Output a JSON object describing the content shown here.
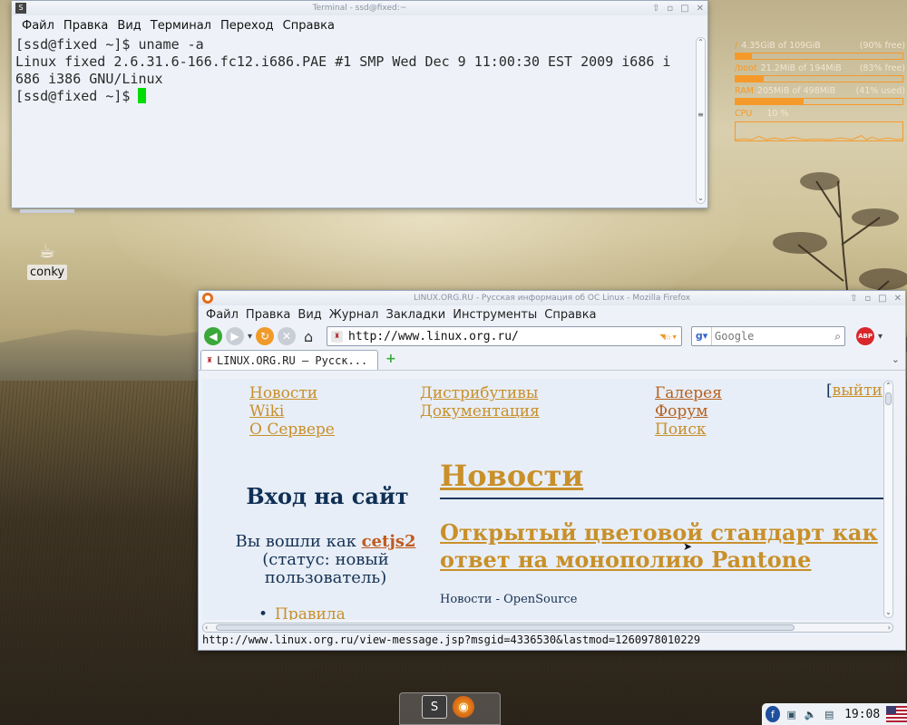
{
  "terminal": {
    "title": "Terminal - ssd@fixed:~",
    "menu": [
      "Файл",
      "Правка",
      "Вид",
      "Терминал",
      "Переход",
      "Справка"
    ],
    "lines": [
      "[ssd@fixed ~]$ uname -a",
      "Linux fixed 2.6.31.6-166.fc12.i686.PAE #1 SMP Wed Dec 9 11:00:30 EST 2009 i686 i",
      "686 i386 GNU/Linux"
    ],
    "prompt": "[ssd@fixed ~]$ ",
    "cursor_color": "#00dd00"
  },
  "conky": {
    "rows": [
      {
        "label": "/",
        "value": "4.35GiB of 109GiB",
        "extra": "(90% free)",
        "fill": 0.1
      },
      {
        "label": "/boot",
        "value": "21.2MiB of 194MiB",
        "extra": "(83% free)",
        "fill": 0.17
      },
      {
        "label": "RAM",
        "value": "205MiB of 498MiB",
        "extra": "(41% used)",
        "fill": 0.41
      }
    ],
    "cpu_label": "CPU",
    "cpu_value": "10 %",
    "accent": "#f59a2a"
  },
  "desktop": {
    "icon_label": "conky"
  },
  "firefox": {
    "title": "LINUX.ORG.RU - Русская информация об ОС Linux - Mozilla Firefox",
    "menu": [
      "Файл",
      "Правка",
      "Вид",
      "Журнал",
      "Закладки",
      "Инструменты",
      "Справка"
    ],
    "url": "http://www.linux.org.ru/",
    "search_placeholder": "Google",
    "abp_label": "ABP",
    "tab_title": "LINUX.ORG.RU – Русск...",
    "status": "http://www.linux.org.ru/view-message.jsp?msgid=4336530&lastmod=1260978010229"
  },
  "page": {
    "nav": {
      "news": "Новости",
      "wiki": "Wiki",
      "about": "О Сервере",
      "distros": "Дистрибутивы",
      "docs": "Документация",
      "gallery": "Галерея",
      "forum": "Форум",
      "search": "Поиск",
      "logout_open": "[",
      "logout": "выйти",
      "logout_close": "]"
    },
    "login_title": "Вход на сайт",
    "logged_as": "Вы вошли как ",
    "username": "cetjs2",
    "status_text": "(статус: новый пользователь)",
    "rules": "Правила",
    "news_heading": "Новости",
    "article_title": "Открытый цветовой стандарт как ответ на монополию Pantone",
    "article_category": "Новости - OpenSource"
  },
  "tray": {
    "clock": "19:08"
  }
}
